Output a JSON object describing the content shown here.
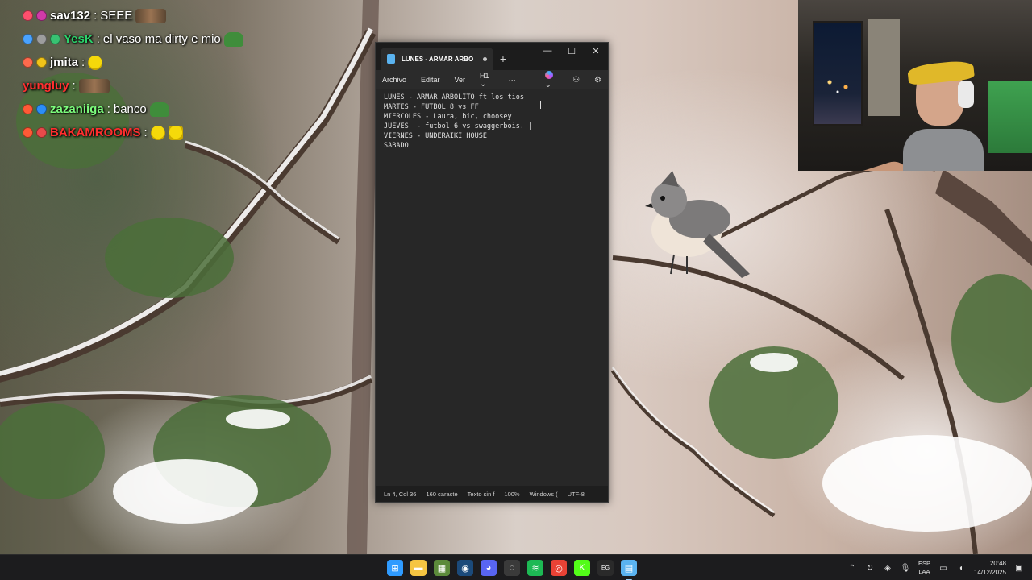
{
  "chat": {
    "messages": [
      {
        "user": "sav132",
        "text": "SEEE",
        "user_color": "#ffffff",
        "badges": [
          "#ff4f6d",
          "#d13aa8"
        ],
        "emotes": [
          "group"
        ]
      },
      {
        "user": "YesK",
        "text": "el vaso ma dirty e mio",
        "user_color": "#2bd36b",
        "badges": [
          "#4aa3ff",
          "#9d9d9d",
          "#38c172"
        ],
        "emotes": [
          "frog"
        ]
      },
      {
        "user": "jmita",
        "text": "",
        "user_color": "#ffffff",
        "badges": [
          "#ff6a4d",
          "#f0c419"
        ],
        "emotes": [
          "face"
        ]
      },
      {
        "user": "yungluy",
        "text": "",
        "user_color": "#ff3030",
        "badges": [],
        "emotes": [
          "group"
        ]
      },
      {
        "user": "zazaniiga",
        "text": "banco",
        "user_color": "#7cfc7c",
        "badges": [
          "#ff5a36",
          "#2c8ef8"
        ],
        "emotes": [
          "frog"
        ]
      },
      {
        "user": "BAKAMROOMS",
        "text": "",
        "user_color": "#ff2e2e",
        "badges": [
          "#ff5a36",
          "#e84a4a"
        ],
        "emotes": [
          "face",
          "face"
        ]
      }
    ]
  },
  "notepad": {
    "tab_title": "LUNES - ARMAR ARBO",
    "new_tab": "+",
    "window_controls": {
      "minimize": "—",
      "maximize": "☐",
      "close": "✕"
    },
    "menu": {
      "file": "Archivo",
      "edit": "Editar",
      "view": "Ver",
      "heading": "H1",
      "more": "···"
    },
    "lines": [
      "LUNES - ARMAR ARBOLITO ft los tios",
      "MARTES - FUTBOL 8 vs FF",
      "MIERCOLES - Laura, bic, choosey",
      "JUEVES  - futbol 6 vs swaggerbois. |",
      "VIERNES - UNDERAIKI HOUSE",
      "SABADO"
    ],
    "status": {
      "position": "Ln 4, Col 36",
      "chars": "160 caracte",
      "format": "Texto sin f",
      "zoom": "100%",
      "line_endings": "Windows (",
      "encoding": "UTF-8"
    }
  },
  "taskbar": {
    "apps": [
      {
        "name": "start",
        "glyph": "⊞",
        "color": "#2f9bff"
      },
      {
        "name": "explorer",
        "glyph": "▬",
        "color": "#f5c542"
      },
      {
        "name": "minecraft",
        "glyph": "▦",
        "color": "#5c8a3b"
      },
      {
        "name": "steam",
        "glyph": "◉",
        "color": "#1b4a7a"
      },
      {
        "name": "discord",
        "glyph": "◕",
        "color": "#5865f2"
      },
      {
        "name": "obs",
        "glyph": "◌",
        "color": "#3a3a3a"
      },
      {
        "name": "spotify",
        "glyph": "≋",
        "color": "#1db954"
      },
      {
        "name": "chrome",
        "glyph": "◎",
        "color": "#e94235"
      },
      {
        "name": "kick",
        "glyph": "K",
        "color": "#53fc18"
      },
      {
        "name": "epic-games",
        "glyph": "EG",
        "color": "#2a2a2a"
      },
      {
        "name": "notepad",
        "glyph": "▤",
        "color": "#5ab3f0"
      }
    ],
    "language": {
      "line1": "ESP",
      "line2": "LAA"
    },
    "time": "20:48",
    "date": "14/12/2025"
  }
}
